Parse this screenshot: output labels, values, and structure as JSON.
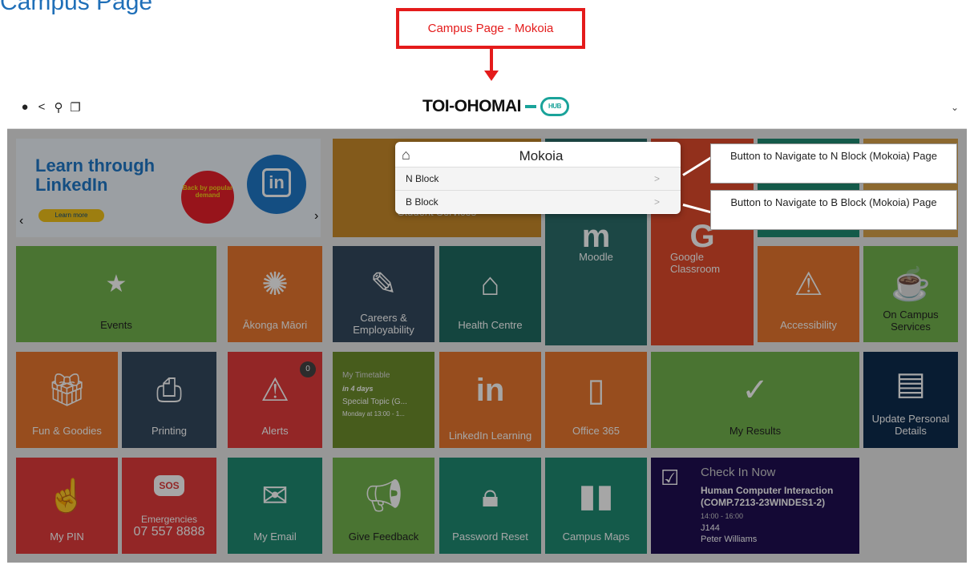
{
  "doc": {
    "title": "Campus Page"
  },
  "callout": {
    "text": "Campus Page - Mokoia"
  },
  "topbar": {
    "icons": [
      "chat-icon",
      "share-icon",
      "search-icon",
      "copy-icon"
    ],
    "brand": "TOI-OHOMAI",
    "brand_hub": "HUB",
    "chevron": "⌄"
  },
  "banner": {
    "title_line1": "Learn through",
    "title_line2": "LinkedIn",
    "button": "Learn more",
    "seal": "Back by popular demand",
    "logo": "in"
  },
  "tiles": {
    "student_services": "Student Services",
    "moodle": "Moodle",
    "google_classroom": "Google Classroom",
    "events": "Events",
    "akonga_maori": "Ākonga Māori",
    "careers": "Careers & Employability",
    "health_centre": "Health Centre",
    "accessibility": "Accessibility",
    "on_campus": "On Campus Services",
    "fun_goodies": "Fun & Goodies",
    "printing": "Printing",
    "alerts": "Alerts",
    "alerts_count": "0",
    "timetable_title": "My Timetable",
    "timetable_when": "in 4 days",
    "timetable_subject": "Special Topic (G...",
    "timetable_time": "Monday at 13:00 - 1...",
    "linkedin_learning": "LinkedIn Learning",
    "office365": "Office 365",
    "my_results": "My Results",
    "update_details": "Update Personal Details",
    "my_pin": "My PIN",
    "emergencies": "Emergencies",
    "emergency_phone": "07 557 8888",
    "sos": "SOS",
    "my_email": "My Email",
    "give_feedback": "Give Feedback",
    "password_reset": "Password Reset",
    "campus_maps": "Campus Maps"
  },
  "checkin": {
    "title": "Check In Now",
    "course": "Human Computer Interaction (COMP.7213-23WINDES1-2)",
    "time": "14:00 - 16:00",
    "room": "J144",
    "lecturer": "Peter Williams"
  },
  "popup": {
    "title": "Mokoia",
    "items": [
      {
        "label": "N Block",
        "chevron": ">"
      },
      {
        "label": "B Block",
        "chevron": ">"
      }
    ]
  },
  "annotations": [
    {
      "text": "Button to Navigate to N Block (Mokoia) Page"
    },
    {
      "text": "Button to Navigate to B Block (Mokoia) Page"
    }
  ],
  "colors": {
    "green": "#72b34e",
    "orange": "#e8772e",
    "slate": "#34495e",
    "teal": "#1f8a72",
    "red": "#e23b3b",
    "navy": "#0d2b4e",
    "purple": "#1f0f52"
  }
}
